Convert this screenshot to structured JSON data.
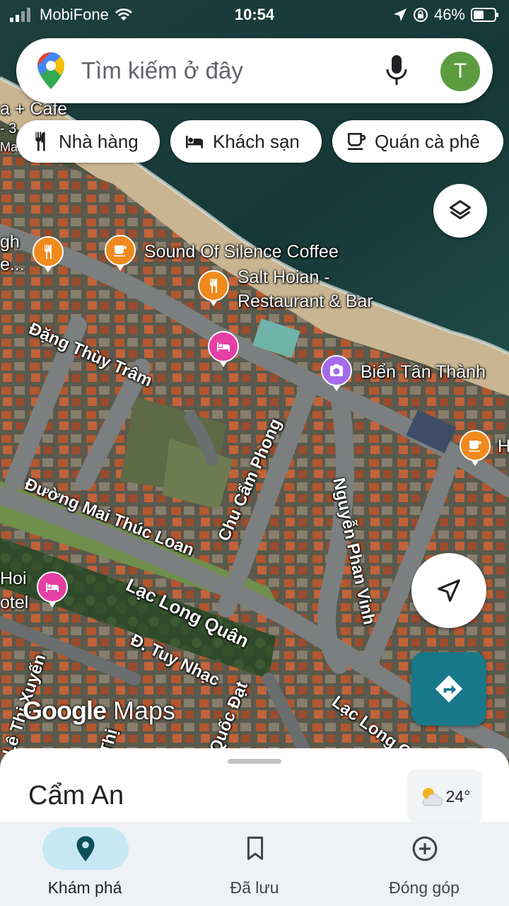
{
  "status_bar": {
    "carrier": "MobiFone",
    "time": "10:54",
    "battery": "46%"
  },
  "search": {
    "placeholder": "Tìm kiếm ở đây",
    "avatar_initial": "T"
  },
  "chips": [
    {
      "label": "Nhà hàng",
      "icon": "restaurant-icon"
    },
    {
      "label": "Khách sạn",
      "icon": "hotel-icon"
    },
    {
      "label": "Quán cà phê",
      "icon": "coffee-icon"
    }
  ],
  "map": {
    "streets": [
      "Đặng Thùy Trâm",
      "Chu Cẩm Phong",
      "Nguyễn Phan Vinh",
      "Đường Mai Thúc Loan",
      "Lạc Long Quân",
      "Đ. Tuy Nhạc",
      "Lê Thị Xuyến",
      "Lạc Long Q",
      "Quốc Đạt",
      "Thị"
    ],
    "pois": [
      {
        "name": "Sound Of Silence Coffee",
        "type": "coffee"
      },
      {
        "name": "Salt Hoian - Restaurant & Bar",
        "line1": "Salt Hoian -",
        "line2": "Restaurant & Bar",
        "type": "restaurant"
      },
      {
        "name": "Biển Tân Thành",
        "type": "photo"
      },
      {
        "name": "a + Cafe",
        "type": "cafe"
      },
      {
        "name": "gh e...",
        "line1": "gh",
        "line2": "e...",
        "type": "restaurant"
      },
      {
        "name": "Hoi otel",
        "line1": "Hoi",
        "line2": "otel",
        "type": "hotel"
      },
      {
        "name": "H",
        "type": "coffee"
      }
    ],
    "partial_labels": {
      "cafe_sub1": "- 3",
      "cafe_sub2": "Ma"
    },
    "watermark": {
      "google": "Google",
      "maps": "Maps"
    }
  },
  "bottom_sheet": {
    "place_title": "Cẩm An",
    "weather": {
      "temperature": "24°",
      "icon": "partly-cloudy-icon"
    }
  },
  "nav": [
    {
      "label": "Khám phá",
      "icon": "explore-pin-icon",
      "active": true
    },
    {
      "label": "Đã lưu",
      "icon": "bookmark-icon",
      "active": false
    },
    {
      "label": "Đóng góp",
      "icon": "add-circle-icon",
      "active": false
    }
  ],
  "colors": {
    "accent_teal": "#17788a",
    "poi_orange": "#f08a1c",
    "poi_pink": "#e63fa3",
    "poi_purple": "#a46bea",
    "avatar_green": "#5c9c3e",
    "nav_active": "#c5e8f3"
  }
}
